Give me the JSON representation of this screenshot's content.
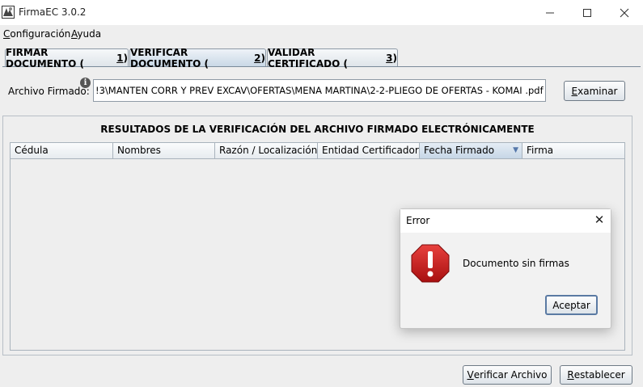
{
  "window": {
    "title": "FirmaEC 3.0.2",
    "controls": [
      "minimize-icon",
      "maximize-icon",
      "close-icon"
    ]
  },
  "menu": {
    "items": [
      {
        "label": "Configuración",
        "mnemonic": "C"
      },
      {
        "label": "Ayuda",
        "mnemonic": "A"
      }
    ]
  },
  "tabs": [
    {
      "pre": "FIRMAR DOCUMENTO (",
      "key": "1",
      "post": ")",
      "active": false
    },
    {
      "pre": "VERIFICAR DOCUMENTO (",
      "key": "2",
      "post": ")",
      "active": true
    },
    {
      "pre": "VALIDAR CERTIFICADO (",
      "key": "3",
      "post": ")",
      "active": false
    }
  ],
  "form": {
    "archivo_label": "Archivo Firmado:",
    "info_glyph": "i",
    "archivo_value": "!3\\MANTEN CORR Y PREV EXCAV\\OFERTAS\\MENA MARTINA\\2-2-PLIEGO DE OFERTAS - KOMAI .pdf",
    "examinar": {
      "key": "E",
      "rest": "xaminar"
    }
  },
  "results": {
    "title": "RESULTADOS DE LA VERIFICACIÓN DEL ARCHIVO FIRMADO ELECTRÓNICAMENTE",
    "columns": [
      "Cédula",
      "Nombres",
      "Razón / Localización",
      "Entidad Certificadora",
      "Fecha Firmado",
      "Firma"
    ],
    "sorted_column": "Fecha Firmado",
    "sort_arrow": "▼",
    "rows": []
  },
  "dialog": {
    "title": "Error",
    "close_glyph": "✕",
    "icon": "error-stop-icon",
    "message": "Documento sin firmas",
    "ok_label": "Aceptar"
  },
  "footer": {
    "verificar": {
      "key": "V",
      "rest": "erificar Archivo"
    },
    "restablecer": {
      "key": "R",
      "rest": "establecer"
    }
  },
  "colors": {
    "error_red": "#cc1f1f",
    "accent_blue": "#5a7aa3"
  }
}
